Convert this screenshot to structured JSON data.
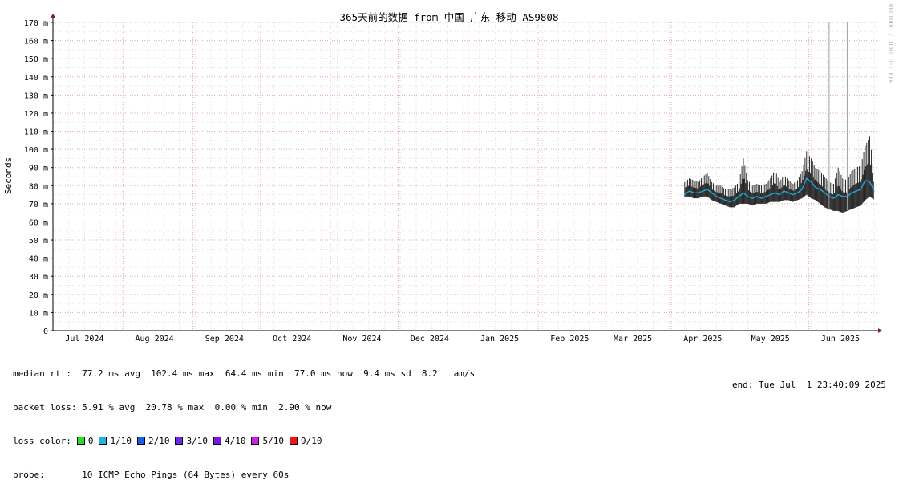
{
  "watermark": "RRDTOOL / TOBI OETIKER",
  "chart_data": {
    "type": "line",
    "title": "365天前的数据 from 中国 广东 移动 AS9808",
    "ylabel": "Seconds",
    "ylim": [
      0,
      170
    ],
    "y_unit_suffix": "m",
    "yticks": [
      0,
      10,
      20,
      30,
      40,
      50,
      60,
      70,
      80,
      90,
      100,
      110,
      120,
      130,
      140,
      150,
      160,
      170
    ],
    "xlim": [
      "2024-07-01",
      "2025-07-01"
    ],
    "month_ticks": [
      {
        "label": "Jul 2024",
        "date": "2024-07-15"
      },
      {
        "label": "Aug 2024",
        "date": "2024-08-15"
      },
      {
        "label": "Sep 2024",
        "date": "2024-09-15"
      },
      {
        "label": "Oct 2024",
        "date": "2024-10-15"
      },
      {
        "label": "Nov 2024",
        "date": "2024-11-15"
      },
      {
        "label": "Dec 2024",
        "date": "2024-12-15"
      },
      {
        "label": "Jan 2025",
        "date": "2025-01-15"
      },
      {
        "label": "Feb 2025",
        "date": "2025-02-15"
      },
      {
        "label": "Mar 2025",
        "date": "2025-03-15"
      },
      {
        "label": "Apr 2025",
        "date": "2025-04-15"
      },
      {
        "label": "May 2025",
        "date": "2025-05-15"
      },
      {
        "label": "Jun 2025",
        "date": "2025-06-15"
      }
    ],
    "month_boundaries": [
      "2024-08-01",
      "2024-09-01",
      "2024-10-01",
      "2024-11-01",
      "2024-12-01",
      "2025-01-01",
      "2025-02-01",
      "2025-03-01",
      "2025-04-01",
      "2025-05-01",
      "2025-06-01"
    ],
    "grid": true,
    "series": [
      {
        "name": "median rtt",
        "color": "#1ea7d6",
        "points": [
          [
            "2025-04-07",
            75
          ],
          [
            "2025-04-09",
            77
          ],
          [
            "2025-04-11",
            76
          ],
          [
            "2025-04-13",
            76
          ],
          [
            "2025-04-15",
            77
          ],
          [
            "2025-04-17",
            78
          ],
          [
            "2025-04-19",
            76
          ],
          [
            "2025-04-21",
            74
          ],
          [
            "2025-04-23",
            73
          ],
          [
            "2025-04-25",
            72
          ],
          [
            "2025-04-27",
            71
          ],
          [
            "2025-04-29",
            72
          ],
          [
            "2025-05-01",
            74
          ],
          [
            "2025-05-03",
            76
          ],
          [
            "2025-05-05",
            74
          ],
          [
            "2025-05-07",
            73
          ],
          [
            "2025-05-09",
            74
          ],
          [
            "2025-05-11",
            73
          ],
          [
            "2025-05-13",
            74
          ],
          [
            "2025-05-15",
            75
          ],
          [
            "2025-05-17",
            76
          ],
          [
            "2025-05-19",
            75
          ],
          [
            "2025-05-21",
            77
          ],
          [
            "2025-05-23",
            76
          ],
          [
            "2025-05-25",
            75
          ],
          [
            "2025-05-27",
            76
          ],
          [
            "2025-05-29",
            78
          ],
          [
            "2025-05-31",
            84
          ],
          [
            "2025-06-02",
            82
          ],
          [
            "2025-06-04",
            79
          ],
          [
            "2025-06-06",
            78
          ],
          [
            "2025-06-08",
            76
          ],
          [
            "2025-06-10",
            74
          ],
          [
            "2025-06-12",
            73
          ],
          [
            "2025-06-14",
            75
          ],
          [
            "2025-06-16",
            74
          ],
          [
            "2025-06-18",
            74
          ],
          [
            "2025-06-20",
            76
          ],
          [
            "2025-06-22",
            77
          ],
          [
            "2025-06-24",
            78
          ],
          [
            "2025-06-26",
            83
          ],
          [
            "2025-06-28",
            82
          ],
          [
            "2025-06-30",
            77
          ]
        ],
        "max": [
          [
            "2025-04-07",
            82
          ],
          [
            "2025-04-09",
            84
          ],
          [
            "2025-04-11",
            83
          ],
          [
            "2025-04-13",
            82
          ],
          [
            "2025-04-15",
            85
          ],
          [
            "2025-04-17",
            87
          ],
          [
            "2025-04-19",
            82
          ],
          [
            "2025-04-21",
            80
          ],
          [
            "2025-04-23",
            80
          ],
          [
            "2025-04-25",
            78
          ],
          [
            "2025-04-27",
            78
          ],
          [
            "2025-04-29",
            79
          ],
          [
            "2025-05-01",
            82
          ],
          [
            "2025-05-03",
            95
          ],
          [
            "2025-05-05",
            83
          ],
          [
            "2025-05-07",
            80
          ],
          [
            "2025-05-09",
            81
          ],
          [
            "2025-05-11",
            80
          ],
          [
            "2025-05-13",
            81
          ],
          [
            "2025-05-15",
            84
          ],
          [
            "2025-05-17",
            89
          ],
          [
            "2025-05-19",
            82
          ],
          [
            "2025-05-21",
            86
          ],
          [
            "2025-05-23",
            83
          ],
          [
            "2025-05-25",
            81
          ],
          [
            "2025-05-27",
            83
          ],
          [
            "2025-05-29",
            88
          ],
          [
            "2025-05-31",
            99
          ],
          [
            "2025-06-02",
            95
          ],
          [
            "2025-06-04",
            90
          ],
          [
            "2025-06-06",
            88
          ],
          [
            "2025-06-08",
            85
          ],
          [
            "2025-06-10",
            82
          ],
          [
            "2025-06-12",
            81
          ],
          [
            "2025-06-14",
            90
          ],
          [
            "2025-06-16",
            84
          ],
          [
            "2025-06-18",
            83
          ],
          [
            "2025-06-20",
            88
          ],
          [
            "2025-06-22",
            90
          ],
          [
            "2025-06-24",
            91
          ],
          [
            "2025-06-26",
            102
          ],
          [
            "2025-06-28",
            107
          ],
          [
            "2025-06-30",
            85
          ]
        ],
        "min": [
          [
            "2025-04-07",
            74
          ],
          [
            "2025-04-09",
            74
          ],
          [
            "2025-04-11",
            73
          ],
          [
            "2025-04-13",
            73
          ],
          [
            "2025-04-15",
            74
          ],
          [
            "2025-04-17",
            74
          ],
          [
            "2025-04-19",
            72
          ],
          [
            "2025-04-21",
            71
          ],
          [
            "2025-04-23",
            70
          ],
          [
            "2025-04-25",
            69
          ],
          [
            "2025-04-27",
            68
          ],
          [
            "2025-04-29",
            68
          ],
          [
            "2025-05-01",
            70
          ],
          [
            "2025-05-03",
            70
          ],
          [
            "2025-05-05",
            70
          ],
          [
            "2025-05-07",
            69
          ],
          [
            "2025-05-09",
            70
          ],
          [
            "2025-05-11",
            70
          ],
          [
            "2025-05-13",
            70
          ],
          [
            "2025-05-15",
            71
          ],
          [
            "2025-05-17",
            71
          ],
          [
            "2025-05-19",
            71
          ],
          [
            "2025-05-21",
            72
          ],
          [
            "2025-05-23",
            72
          ],
          [
            "2025-05-25",
            71
          ],
          [
            "2025-05-27",
            72
          ],
          [
            "2025-05-29",
            73
          ],
          [
            "2025-05-31",
            75
          ],
          [
            "2025-06-02",
            73
          ],
          [
            "2025-06-04",
            72
          ],
          [
            "2025-06-06",
            70
          ],
          [
            "2025-06-08",
            68
          ],
          [
            "2025-06-10",
            67
          ],
          [
            "2025-06-12",
            66
          ],
          [
            "2025-06-14",
            66
          ],
          [
            "2025-06-16",
            65
          ],
          [
            "2025-06-18",
            66
          ],
          [
            "2025-06-20",
            67
          ],
          [
            "2025-06-22",
            68
          ],
          [
            "2025-06-24",
            69
          ],
          [
            "2025-06-26",
            72
          ],
          [
            "2025-06-28",
            74
          ],
          [
            "2025-06-30",
            72
          ]
        ]
      }
    ],
    "spikes": [
      {
        "date": "2025-06-10",
        "value": 170
      },
      {
        "date": "2025-06-18",
        "value": 170
      }
    ]
  },
  "stats": {
    "median_rtt": "median rtt:  77.2 ms avg  102.4 ms max  64.4 ms min  77.0 ms now  9.4 ms sd  8.2   am/s",
    "packet_loss": "packet loss: 5.91 % avg  20.78 % max  0.00 % min  2.90 % now",
    "loss_color_label": "loss color:",
    "loss_colors": [
      {
        "label": "0",
        "color": "#26e026"
      },
      {
        "label": "1/10",
        "color": "#1eb4e6"
      },
      {
        "label": "2/10",
        "color": "#1c5fe6"
      },
      {
        "label": "3/10",
        "color": "#6a2ae8"
      },
      {
        "label": "4/10",
        "color": "#7a18e0"
      },
      {
        "label": "5/10",
        "color": "#d61ee8"
      },
      {
        "label": "9/10",
        "color": "#ee1616"
      }
    ],
    "probe_label": "probe:",
    "probe": "10 ICMP Echo Pings (64 Bytes) every 60s",
    "end": "end: Tue Jul  1 23:40:09 2025"
  }
}
